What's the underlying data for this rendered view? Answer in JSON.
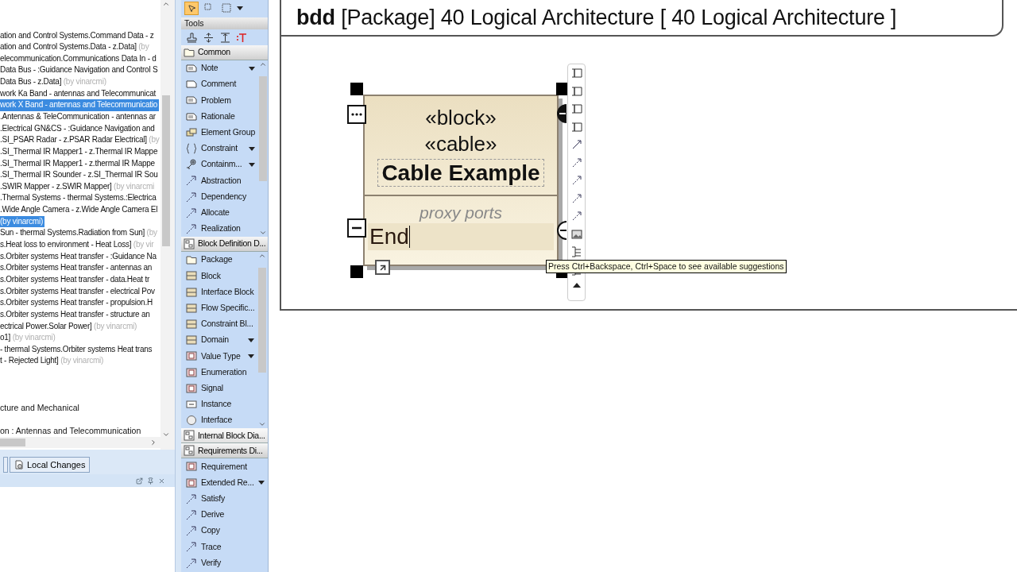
{
  "tree": {
    "rows": [
      {
        "text": "ation and Control Systems.Command Data - z",
        "selected": false
      },
      {
        "text": "ation and Control Systems.Data - z.Data]",
        "author": "(by",
        "selected": false
      },
      {
        "text": "elecommunication.Communications Data In - d",
        "selected": false
      },
      {
        "text": "Data Bus - :Guidance Navigation and Control S",
        "selected": false
      },
      {
        "text": "Data Bus - z.Data]",
        "author": "(by vinarcmi)",
        "selected": false
      },
      {
        "text": "work Ka Band - antennas and Telecommunicat",
        "selected": false
      },
      {
        "text": "work X Band - antennas and Telecommunicatio",
        "selected": true
      },
      {
        "text": ".Antennas & TeleCommunication - antennas ar",
        "selected": false
      },
      {
        "text": ".Electrical GN&CS - :Guidance Navigation and",
        "selected": false
      },
      {
        "text": ".SI_PSAR Radar - z.PSAR Radar Electrical]",
        "author": "(by",
        "selected": false
      },
      {
        "text": ".SI_Thermal IR Mapper1 - z.Thermal IR Mappe",
        "selected": false
      },
      {
        "text": ".SI_Thermal IR Mapper1 - z.thermal IR Mappe",
        "selected": false
      },
      {
        "text": ".SI_Thermal IR Sounder - z.SI_Thermal IR Sou",
        "selected": false
      },
      {
        "text": ".SWIR Mapper - z.SWIR Mapper]",
        "author": "(by vinarcmi",
        "selected": false
      },
      {
        "text": ".Thermal Systems - thermal Systems.:Electrica",
        "selected": false
      },
      {
        "text": ".Wide Angle Camera - z.Wide Angle Camera El",
        "selected": false
      },
      {
        "text": "(by vinarcmi)",
        "selected": true
      },
      {
        "text": "Sun - thermal Systems.Radiation from Sun]",
        "author": "(by",
        "selected": false
      },
      {
        "text": "s.Heat loss to environment - Heat Loss]",
        "author": "(by vir",
        "selected": false
      },
      {
        "text": "s.Orbiter systems Heat transfer - :Guidance Na",
        "selected": false
      },
      {
        "text": "s.Orbiter systems Heat transfer - antennas an",
        "selected": false
      },
      {
        "text": "s.Orbiter systems Heat transfer - data.Heat tr",
        "selected": false
      },
      {
        "text": "s.Orbiter systems Heat transfer - electrical Pov",
        "selected": false
      },
      {
        "text": "s.Orbiter systems Heat transfer - propulsion.H",
        "selected": false
      },
      {
        "text": "s.Orbiter systems Heat transfer - structure an",
        "selected": false
      },
      {
        "text": "ectrical Power.Solar Power]",
        "author": "(by vinarcmi)",
        "selected": false
      },
      {
        "text": "o1]",
        "author": "(by vinarcmi)",
        "selected": false
      },
      {
        "text": " - thermal Systems.Orbiter systems Heat trans",
        "selected": false
      },
      {
        "text": "t - Rejected Light]",
        "author": "(by vinarcmi)",
        "selected": false
      }
    ],
    "lower_rows": [
      {
        "text": "cture and Mechanical",
        "selected": false
      },
      {
        "text": "on : Antennas and Telecommunication",
        "selected": false
      }
    ]
  },
  "bottom_tabs": [
    {
      "label": "Local Changes",
      "selected": false
    }
  ],
  "palette": {
    "pointer_tools": [
      {
        "selected": true
      },
      {
        "selected": false
      },
      {
        "selected": false
      }
    ],
    "tools_title": "Tools",
    "groups": [
      {
        "title": "Common",
        "kind": "folder",
        "expanded": true,
        "items": [
          {
            "label": "Note",
            "kind": "note",
            "has_menu": true
          },
          {
            "label": "Comment",
            "kind": "comment",
            "has_menu": false
          },
          {
            "label": "Problem",
            "kind": "note",
            "has_menu": false
          },
          {
            "label": "Rationale",
            "kind": "note",
            "has_menu": false
          },
          {
            "label": "Element Group",
            "kind": "group",
            "has_menu": false
          },
          {
            "label": "Constraint",
            "kind": "braces",
            "has_menu": true
          },
          {
            "label": "Containm...",
            "kind": "containment",
            "has_menu": true
          },
          {
            "label": "Abstraction",
            "kind": "arrow",
            "has_menu": false
          },
          {
            "label": "Dependency",
            "kind": "arrow",
            "has_menu": false
          },
          {
            "label": "Allocate",
            "kind": "arrow",
            "has_menu": false
          },
          {
            "label": "Realization",
            "kind": "arrow",
            "has_menu": false
          }
        ]
      },
      {
        "title": "Block Definition D...",
        "kind": "diagram",
        "expanded": true,
        "items": [
          {
            "label": "Package",
            "kind": "folder",
            "has_menu": false
          },
          {
            "label": "Block",
            "kind": "block",
            "has_menu": false
          },
          {
            "label": "Interface Block",
            "kind": "block",
            "has_menu": false
          },
          {
            "label": "Flow Specific...",
            "kind": "block",
            "has_menu": false
          },
          {
            "label": "Constraint Bl...",
            "kind": "block",
            "has_menu": false
          },
          {
            "label": "Domain",
            "kind": "block",
            "has_menu": true
          },
          {
            "label": "Value Type",
            "kind": "tag",
            "has_menu": true
          },
          {
            "label": "Enumeration",
            "kind": "tag",
            "has_menu": false
          },
          {
            "label": "Signal",
            "kind": "tag",
            "has_menu": false
          },
          {
            "label": "Instance",
            "kind": "minus",
            "has_menu": false
          },
          {
            "label": "Interface",
            "kind": "circle",
            "has_menu": false
          }
        ]
      },
      {
        "title": "Internal Block Dia...",
        "kind": "diagram",
        "expanded": false
      },
      {
        "title": "Requirements Di...",
        "kind": "diagram",
        "expanded": true,
        "items": [
          {
            "label": "Requirement",
            "kind": "tag",
            "has_menu": false
          },
          {
            "label": "Extended Re...",
            "kind": "tag",
            "has_menu": true
          },
          {
            "label": "Satisfy",
            "kind": "arrow",
            "has_menu": false
          },
          {
            "label": "Derive",
            "kind": "arrow",
            "has_menu": false
          },
          {
            "label": "Copy",
            "kind": "arrow",
            "has_menu": false
          },
          {
            "label": "Trace",
            "kind": "arrow",
            "has_menu": false
          },
          {
            "label": "Verify",
            "kind": "arrow",
            "has_menu": false
          }
        ]
      }
    ]
  },
  "diagram": {
    "title": "**bdd** [Package] 40 Logical Architecture [ 40 Logical Architecture ]",
    "block": {
      "selected": true,
      "stereotypes": [
        "«block»",
        "«cable»"
      ],
      "name": "Cable Example",
      "compartment": "proxy ports",
      "editing_value": "End"
    },
    "tooltip": "Press Ctrl+Backspace, Ctrl+Space to see available suggestions"
  }
}
